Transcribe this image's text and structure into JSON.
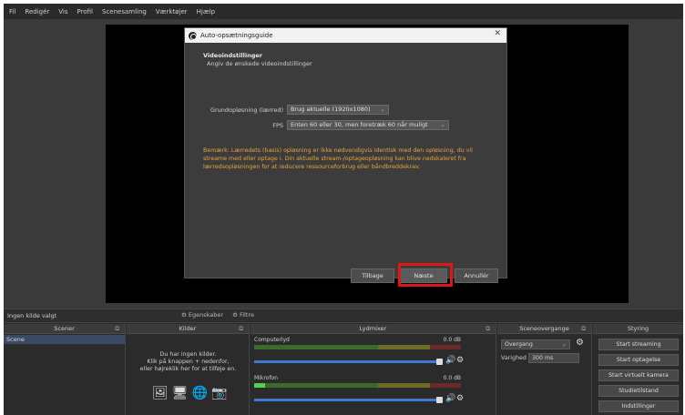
{
  "menubar": {
    "items": [
      "Fil",
      "Redigér",
      "Vis",
      "Profil",
      "Scenesamling",
      "Værktøjer",
      "Hjælp"
    ]
  },
  "dialog": {
    "title": "Auto-opsætningsguide",
    "close": "✕",
    "heading": "Videoindstillinger",
    "subheading": "Angiv de ønskede videoindstillinger",
    "resolution_label": "Grundopløsning (lærred)",
    "resolution_value": "Brug aktuelle (1920x1080)",
    "fps_label": "FPS",
    "fps_value": "Enten 60 eller 30, men foretræk 60 når muligt",
    "warning": "Bemærk: Lærredets (basis) opløsning er ikke nødvendigvis identisk med den opløsning, du vil streame med eller optage i. Din aktuelle stream-/optageopløsning kan blive nedskaleret fra lærredsopløsningen for at reducere ressourceforbrug eller båndbreddekrav.",
    "buttons": {
      "back": "Tilbage",
      "next": "Næste",
      "cancel": "Annullér"
    }
  },
  "sources_bar": {
    "label": "Ingen kilde valgt",
    "properties": "Egenskaber",
    "filters": "Filtre"
  },
  "docks": {
    "scenes": {
      "title": "Scener",
      "items": [
        "Scene"
      ]
    },
    "sources": {
      "title": "Kilder",
      "empty_text": [
        "Du har ingen kilder.",
        "Klik på knappen + nedenfor,",
        "eller højreklik her for at tilføje en."
      ]
    },
    "mixer": {
      "title": "Lydmixer",
      "tracks": [
        {
          "name": "Computerlyd",
          "db": "0.0 dB",
          "level": 0.78
        },
        {
          "name": "Mikrofon",
          "db": "0.0 dB",
          "level": 0.78
        }
      ],
      "scale": [
        "-60",
        "-55",
        "-50",
        "-45",
        "-40",
        "-35",
        "-30",
        "-25",
        "-20",
        "-15",
        "-10",
        "-5",
        "0"
      ]
    },
    "transitions": {
      "title": "Sceneovergange",
      "type": "Overgang",
      "duration_label": "Varighed",
      "duration_value": "300 ms"
    },
    "controls": {
      "title": "Styring",
      "buttons": [
        "Start streaming",
        "Start optagelse",
        "Start virtuelt kamera",
        "Studietilstand",
        "Indstillinger"
      ]
    }
  },
  "colors": {
    "accent": "#3d7ad6",
    "warning": "#e8a43a",
    "highlight": "#e01515"
  }
}
